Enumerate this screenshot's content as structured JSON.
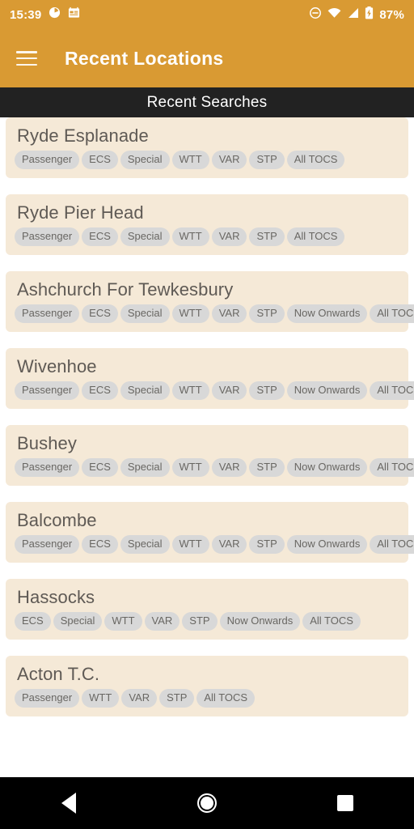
{
  "status_bar": {
    "time": "15:39",
    "battery_percent": "87%",
    "icons": [
      "clock-icon",
      "calendar-icon",
      "do-not-disturb-icon",
      "wifi-icon",
      "signal-icon",
      "battery-charging-icon"
    ]
  },
  "app_bar": {
    "title": "Recent Locations",
    "menu_icon": "hamburger-menu-icon",
    "background_color": "#D99A33"
  },
  "section_header": {
    "title": "Recent Searches",
    "background_color": "#222222"
  },
  "theme": {
    "card_background": "#F5E9D7",
    "chip_background": "#D8D8D8",
    "chip_text": "#696763",
    "title_text": "#5F5A55",
    "accent": "#D99A33"
  },
  "recent_searches": [
    {
      "name": "Ryde Esplanade",
      "chips": [
        "Passenger",
        "ECS",
        "Special",
        "WTT",
        "VAR",
        "STP",
        "All TOCS"
      ]
    },
    {
      "name": "Ryde Pier Head",
      "chips": [
        "Passenger",
        "ECS",
        "Special",
        "WTT",
        "VAR",
        "STP",
        "All TOCS"
      ]
    },
    {
      "name": "Ashchurch For Tewkesbury",
      "chips": [
        "Passenger",
        "ECS",
        "Special",
        "WTT",
        "VAR",
        "STP",
        "Now Onwards",
        "All TOCS"
      ]
    },
    {
      "name": "Wivenhoe",
      "chips": [
        "Passenger",
        "ECS",
        "Special",
        "WTT",
        "VAR",
        "STP",
        "Now Onwards",
        "All TOCS"
      ]
    },
    {
      "name": "Bushey",
      "chips": [
        "Passenger",
        "ECS",
        "Special",
        "WTT",
        "VAR",
        "STP",
        "Now Onwards",
        "All TOCS"
      ]
    },
    {
      "name": "Balcombe",
      "chips": [
        "Passenger",
        "ECS",
        "Special",
        "WTT",
        "VAR",
        "STP",
        "Now Onwards",
        "All TOCS"
      ]
    },
    {
      "name": "Hassocks",
      "chips": [
        "ECS",
        "Special",
        "WTT",
        "VAR",
        "STP",
        "Now Onwards",
        "All TOCS"
      ]
    },
    {
      "name": "Acton T.C.",
      "chips": [
        "Passenger",
        "WTT",
        "VAR",
        "STP",
        "All TOCS"
      ]
    }
  ],
  "nav_bar": {
    "back_label": "back-icon",
    "home_label": "home-icon",
    "recents_label": "recents-icon"
  }
}
